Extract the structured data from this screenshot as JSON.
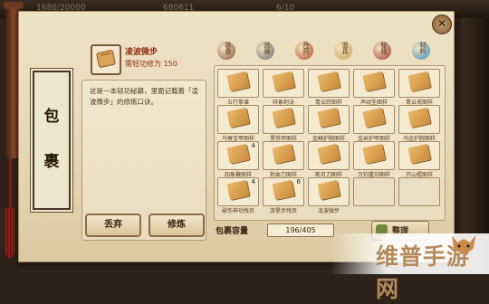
{
  "top_bar": {
    "left_text": "1680/20000",
    "center_text": "680611",
    "right_text": "6/10"
  },
  "side_label": {
    "chars": [
      "包",
      "裹"
    ]
  },
  "item": {
    "name": "凌波微步",
    "subtitle": "需轻功修为 150",
    "description": "这是一本轻功秘籍，里面记载着「凌波微步」的修炼口诀。"
  },
  "buttons": {
    "discard": "丢弃",
    "practice": "修炼"
  },
  "tabs": [
    {
      "label": "装备",
      "icon": "helmet-icon",
      "color": "#8a5a3a"
    },
    {
      "label": "武器",
      "icon": "sword-icon",
      "color": "#6a6a78"
    },
    {
      "label": "丹药",
      "icon": "pill-gourd-icon",
      "color": "#b24a2a"
    },
    {
      "label": "道具",
      "icon": "scroll-icon",
      "color": "#c9a25a"
    },
    {
      "label": "秘籍",
      "icon": "book-icon",
      "color": "#a33b2b"
    },
    {
      "label": "材料",
      "icon": "gem-icon",
      "color": "#3d8fc4"
    }
  ],
  "grid": {
    "items": [
      {
        "name": "五行拳谱",
        "count": ""
      },
      {
        "name": "碎象刺诀",
        "count": ""
      },
      {
        "name": "青云踪图样",
        "count": ""
      },
      {
        "name": "声纹坠图样",
        "count": ""
      },
      {
        "name": "青云戒图样",
        "count": ""
      },
      {
        "name": "乌蚕宝甲图样",
        "count": ""
      },
      {
        "name": "黑铁甲图样",
        "count": ""
      },
      {
        "name": "金鳞护腕图样",
        "count": ""
      },
      {
        "name": "金丝护甲图样",
        "count": ""
      },
      {
        "name": "乌金护腕图样",
        "count": ""
      },
      {
        "name": "四象鞭图样",
        "count": "4"
      },
      {
        "name": "刺血刀图样",
        "count": ""
      },
      {
        "name": "断月刀图样",
        "count": ""
      },
      {
        "name": "万钧重剑图样",
        "count": ""
      },
      {
        "name": "开山棍图样",
        "count": ""
      },
      {
        "name": "破伤神功残页",
        "count": "4"
      },
      {
        "name": "游星步残页",
        "count": "6"
      },
      {
        "name": "凌波微步",
        "count": ""
      },
      {
        "name": "",
        "count": ""
      },
      {
        "name": "",
        "count": ""
      }
    ]
  },
  "capacity": {
    "label": "包裹容量",
    "value": "196/405",
    "fraction": 0.484
  },
  "sort_label": "整理",
  "close_glyph": "✕",
  "watermark": "维普手游网",
  "colors": {
    "parchment": "#e6d6b2",
    "border": "#8a6b45",
    "accent_red": "#8a2f12"
  }
}
